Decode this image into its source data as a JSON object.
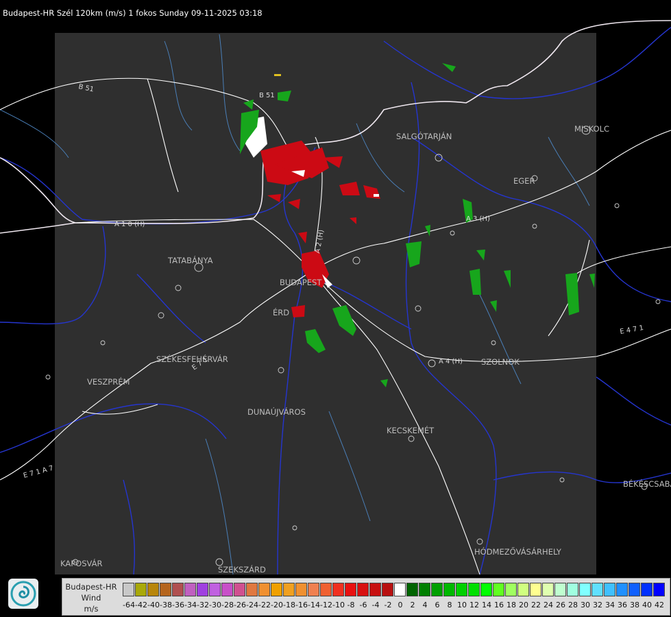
{
  "title": "Budapest-HR Szél 120km (m/s) 1 fokos Sunday 09-11-2025 03:18",
  "cities": [
    {
      "name": "SALGÓTARJÁN"
    },
    {
      "name": "MISKOLC"
    },
    {
      "name": "EGER"
    },
    {
      "name": "TATABÁNYA"
    },
    {
      "name": "BUDAPEST"
    },
    {
      "name": "ÉRD"
    },
    {
      "name": "SZÉKESFEHÉRVÁR"
    },
    {
      "name": "VESZPRÉM"
    },
    {
      "name": "DUNAÚJVÁROS"
    },
    {
      "name": "KECSKEMÉT"
    },
    {
      "name": "SZOLNOK"
    },
    {
      "name": "BÉKÉSCSABA"
    },
    {
      "name": "HÓDMEZŐVÁSÁRHELY"
    },
    {
      "name": "KAPOSVÁR"
    },
    {
      "name": "SZEKSZÁRD"
    }
  ],
  "roads": [
    "B 51",
    "B 51",
    "A 1 0 (H)",
    "A 3 (H)",
    "A 2 (H)",
    "A 4 (H)",
    "E 4 7 1",
    "E 7 1 A 7",
    "E 7 1"
  ],
  "legend": {
    "line1": "Budapest-HR",
    "line2": "Wind",
    "line3": "m/s",
    "ticks": [
      "-64",
      "-42",
      "-40",
      "-38",
      "-36",
      "-34",
      "-32",
      "-30",
      "-28",
      "-26",
      "-24",
      "-22",
      "-20",
      "-18",
      "-16",
      "-14",
      "-12",
      "-10",
      "-8",
      "-6",
      "-4",
      "-2",
      "0",
      "2",
      "4",
      "6",
      "8",
      "10",
      "12",
      "14",
      "16",
      "18",
      "20",
      "22",
      "24",
      "26",
      "28",
      "30",
      "32",
      "34",
      "36",
      "38",
      "40",
      "42"
    ],
    "colors": [
      "#c8c8c8",
      "#a9a90a",
      "#b8860b",
      "#b5651d",
      "#b05050",
      "#c060c0",
      "#a040e0",
      "#c060e0",
      "#c850c8",
      "#d05090",
      "#e07840",
      "#f09030",
      "#f0a000",
      "#f0a020",
      "#f09030",
      "#f08050",
      "#f06030",
      "#f03020",
      "#e81010",
      "#d81010",
      "#c81010",
      "#b81010",
      "#ffffff",
      "#006400",
      "#008000",
      "#00a000",
      "#00b800",
      "#00d000",
      "#00e000",
      "#00ff00",
      "#60ff20",
      "#a0ff60",
      "#d0ff80",
      "#ffff90",
      "#e0ffb0",
      "#c0ffd0",
      "#a0ffe0",
      "#80ffff",
      "#60e0ff",
      "#40c0ff",
      "#2090ff",
      "#1060ff",
      "#0030ff",
      "#0000ff"
    ]
  }
}
